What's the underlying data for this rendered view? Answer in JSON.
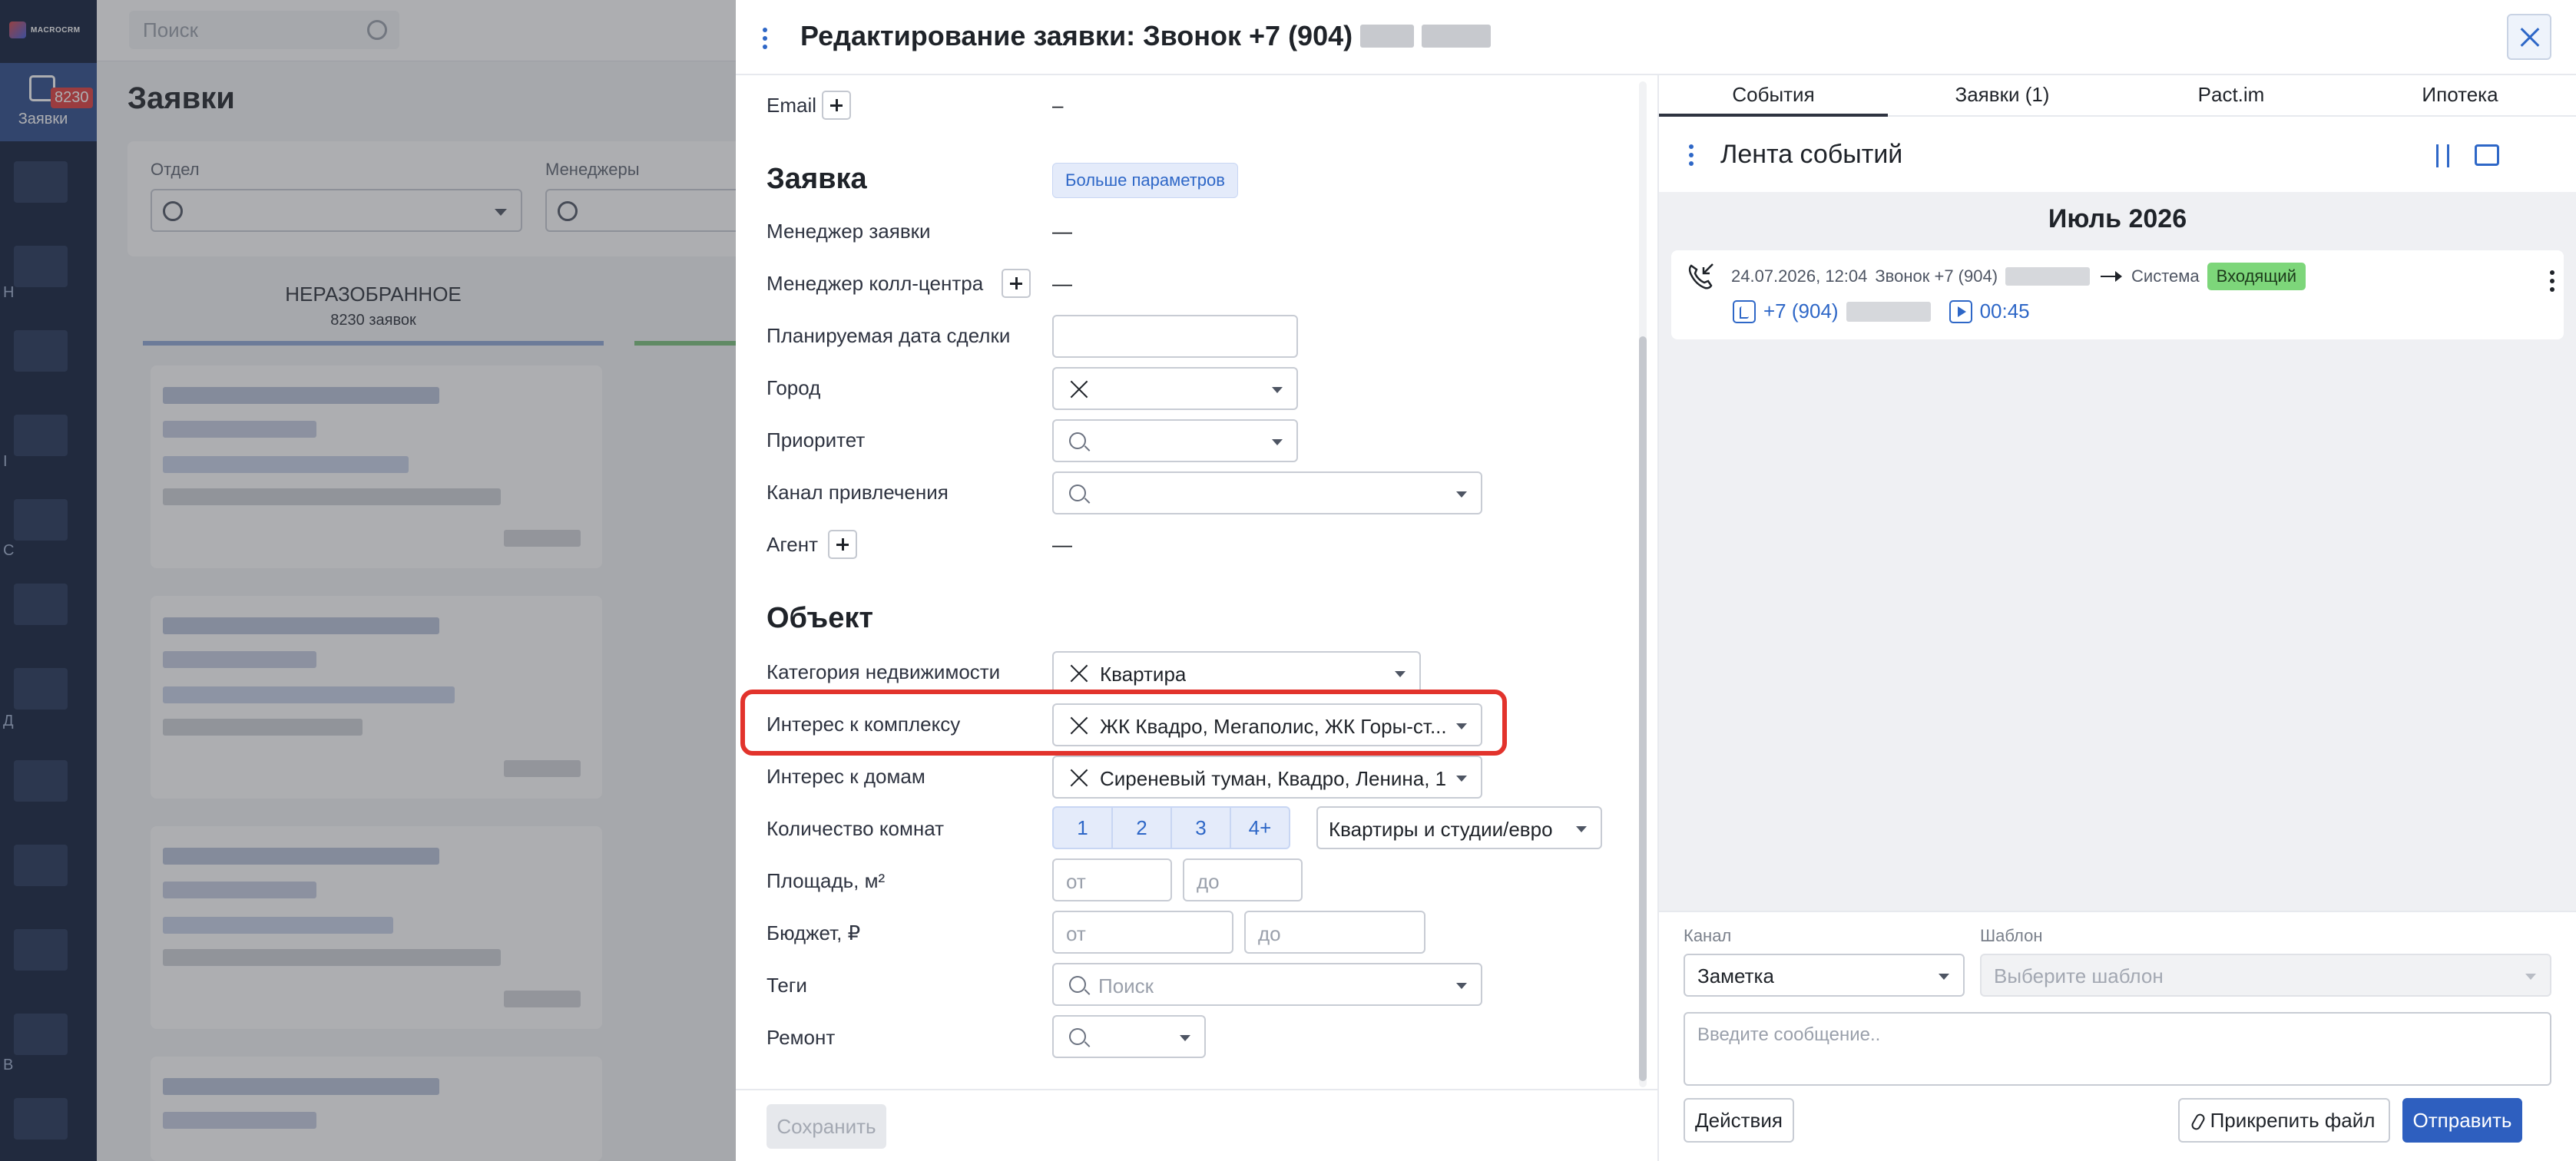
{
  "app": {
    "logo_text": "MACROCRM",
    "search_placeholder": "Поиск",
    "rail_active_label": "Заявки",
    "rail_badge": "8230",
    "rail_letters": [
      "Н",
      "I",
      "С",
      "Д",
      "В"
    ],
    "page_title": "Заявки",
    "filters": [
      {
        "label": "Отдел"
      },
      {
        "label": "Менеджеры"
      }
    ],
    "column_title": "НЕРАЗОБРАННОЕ",
    "column_count": "8230 заявок"
  },
  "modal": {
    "title": "Редактирование заявки: Звонок +7 (904)",
    "close_label": "close"
  },
  "form": {
    "email_label": "Email",
    "email_value": "–",
    "section_request": "Заявка",
    "more_params": "Больше параметров",
    "manager_label": "Менеджер заявки",
    "manager_value": "—",
    "callcenter_label": "Менеджер колл-центра",
    "callcenter_value": "—",
    "deal_date_label": "Планируемая дата сделки",
    "city_label": "Город",
    "priority_label": "Приоритет",
    "channel_label": "Канал привлечения",
    "agent_label": "Агент",
    "agent_value": "—",
    "section_object": "Объект",
    "category_label": "Категория недвижимости",
    "category_value": "Квартира",
    "complex_label": "Интерес к комплексу",
    "complex_value": "ЖК Квадро, Мегаполис, ЖК Горы-ст...",
    "houses_label": "Интерес к домам",
    "houses_value": "Сиреневый туман, Квадро, Ленина, 1...",
    "rooms_label": "Количество комнат",
    "rooms": [
      "1",
      "2",
      "3",
      "4+"
    ],
    "rooms_type": "Квартиры и студии/евро",
    "area_label": "Площадь, м²",
    "budget_label": "Бюджет, ₽",
    "from_placeholder": "от",
    "to_placeholder": "до",
    "tags_label": "Теги",
    "tags_placeholder": "Поиск",
    "repair_label": "Ремонт",
    "save_label": "Сохранить"
  },
  "events": {
    "tabs": [
      "События",
      "Заявки (1)",
      "Pact.im",
      "Ипотека"
    ],
    "active_tab": 0,
    "feed_title": "Лента событий",
    "month": "Июль 2026",
    "card": {
      "datetime": "24.07.2026, 12:04",
      "call_text": "Звонок +7 (904)",
      "target": "Система",
      "badge": "Входящий",
      "phone": "+7 (904)",
      "duration": "00:45"
    }
  },
  "compose": {
    "channel_label": "Канал",
    "template_label": "Шаблон",
    "channel_value": "Заметка",
    "template_placeholder": "Выберите шаблон",
    "message_placeholder": "Введите сообщение..",
    "actions_label": "Действия",
    "attach_label": "Прикрепить файл",
    "send_label": "Отправить"
  },
  "colors": {
    "accent": "#2e67c7",
    "primary_button": "#2e5fbf",
    "highlight": "#e2332c",
    "badge_incoming": "#7dd67a",
    "rail": "#0f1d3a"
  }
}
